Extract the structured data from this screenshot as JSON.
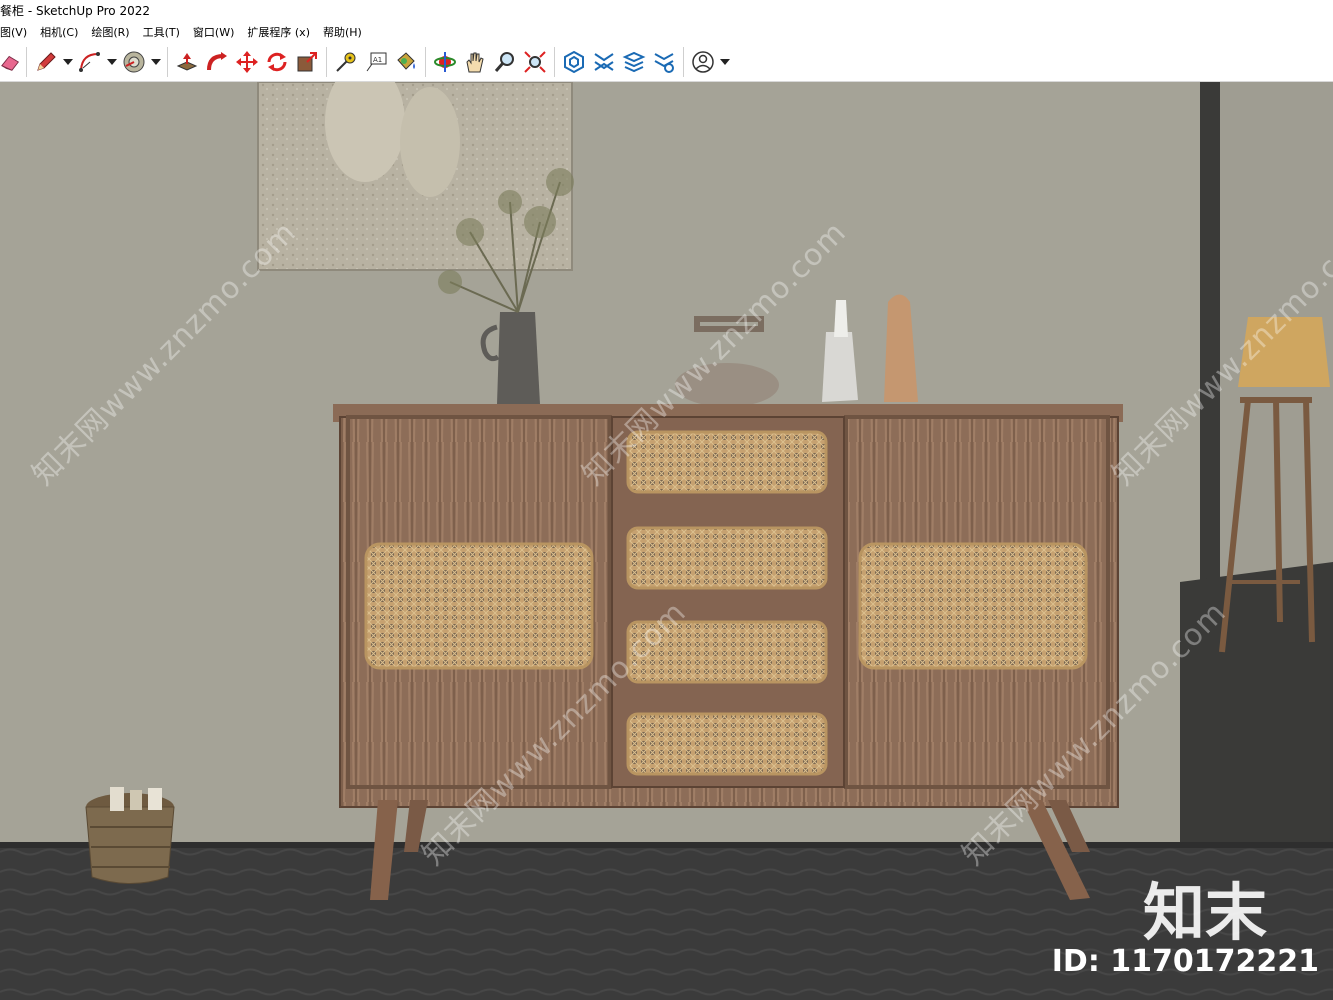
{
  "window": {
    "title": "餐柜 - SketchUp Pro 2022"
  },
  "menu": [
    {
      "label": "图(V)"
    },
    {
      "label": "相机(C)"
    },
    {
      "label": "绘图(R)"
    },
    {
      "label": "工具(T)"
    },
    {
      "label": "窗口(W)"
    },
    {
      "label": "扩展程序 (x)"
    },
    {
      "label": "帮助(H)"
    }
  ],
  "toolbar": {
    "tools": [
      "eraser-icon",
      "pencil-icon",
      "arc-icon",
      "protractor-icon",
      "push-pull-icon",
      "follow-me-icon",
      "move-icon",
      "rotate-icon",
      "scale-icon",
      "tape-measure-icon",
      "text-icon",
      "paint-bucket-icon",
      "orbit-icon",
      "pan-icon",
      "zoom-icon",
      "zoom-extents-icon",
      "warehouse-icon",
      "extension-warehouse-icon",
      "layout-icon",
      "extension-manager-icon",
      "account-icon"
    ]
  },
  "viewport": {
    "watermark": "知末网www.znzmo.com",
    "brand": "知末",
    "id_label": "ID: 1170172221"
  },
  "colors": {
    "wall": "#a5a397",
    "floor": "#3a3a3a",
    "wood": "#8a6a55",
    "rattan": "#c9a777"
  }
}
